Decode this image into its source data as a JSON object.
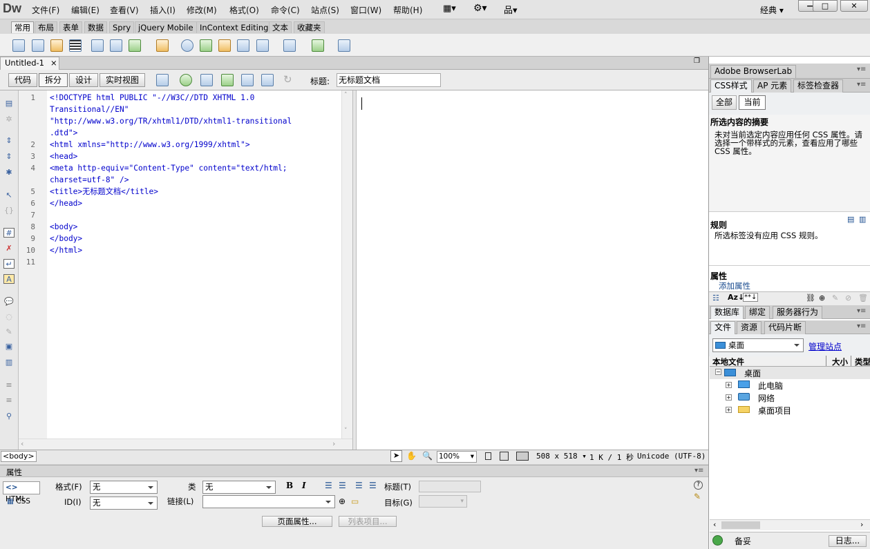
{
  "app": {
    "logo": "Dw",
    "workspace": "经典"
  },
  "menubar": {
    "items": [
      "文件(F)",
      "编辑(E)",
      "查看(V)",
      "插入(I)",
      "修改(M)",
      "格式(O)",
      "命令(C)",
      "站点(S)",
      "窗口(W)",
      "帮助(H)"
    ]
  },
  "window_controls": {
    "minimize": "—",
    "maximize": "□",
    "close": "✕"
  },
  "insert_tabs": [
    "常用",
    "布局",
    "表单",
    "数据",
    "Spry",
    "jQuery Mobile",
    "InContext Editing",
    "文本",
    "收藏夹"
  ],
  "document": {
    "tab": "Untitled-1",
    "close": "×"
  },
  "view_buttons": [
    "代码",
    "拆分",
    "设计",
    "实时视图"
  ],
  "title_label": "标题:",
  "title_value": "无标题文档",
  "code_lines": [
    {
      "n": "1",
      "t": "<!DOCTYPE html PUBLIC \"-//W3C//DTD XHTML 1.0"
    },
    {
      "n": "",
      "t": "Transitional//EN\""
    },
    {
      "n": "",
      "t": "\"http://www.w3.org/TR/xhtml1/DTD/xhtml1-transitional"
    },
    {
      "n": "",
      "t": ".dtd\">"
    },
    {
      "n": "2",
      "t": "<html xmlns=\"http://www.w3.org/1999/xhtml\">"
    },
    {
      "n": "3",
      "t": "<head>"
    },
    {
      "n": "4",
      "t": "<meta http-equiv=\"Content-Type\" content=\"text/html;"
    },
    {
      "n": "",
      "t": "charset=utf-8\" />"
    },
    {
      "n": "5",
      "t": "<title>无标题文档</title>"
    },
    {
      "n": "6",
      "t": "</head>"
    },
    {
      "n": "7",
      "t": ""
    },
    {
      "n": "8",
      "t": "<body>"
    },
    {
      "n": "9",
      "t": "</body>"
    },
    {
      "n": "10",
      "t": "</html>"
    },
    {
      "n": "11",
      "t": ""
    }
  ],
  "status": {
    "tag": "<body>",
    "zoom": "100%",
    "size": "508 x 518",
    "weight": "1 K / 1 秒",
    "encoding": "Unicode (UTF-8)"
  },
  "properties": {
    "header": "属性",
    "html_btn": "HTML",
    "css_btn": "CSS",
    "format_label": "格式(F)",
    "format_value": "无",
    "id_label": "ID(I)",
    "id_value": "无",
    "class_label": "类",
    "class_value": "无",
    "link_label": "链接(L)",
    "link_value": "",
    "title_label": "标题(T)",
    "target_label": "目标(G)",
    "page_props": "页面属性...",
    "list_item": "列表项目..."
  },
  "right": {
    "browserlab": "Adobe BrowserLab",
    "css_tabs": [
      "CSS样式",
      "AP 元素",
      "标签检查器"
    ],
    "mode_all": "全部",
    "mode_current": "当前",
    "summary_title": "所选内容的摘要",
    "summary_text": "未对当前选定内容应用任何 CSS 属性。请选择一个带样式的元素，查看应用了哪些 CSS 属性。",
    "rules_title": "规则",
    "rules_text": "所选标签没有应用 CSS 规则。",
    "attrs_title": "属性",
    "add_attr": "添加属性",
    "db_tabs": [
      "数据库",
      "绑定",
      "服务器行为"
    ],
    "file_tabs": [
      "文件",
      "资源",
      "代码片断"
    ],
    "site_select": "桌面",
    "manage_site": "管理站点",
    "col_local": "本地文件",
    "col_size": "大小",
    "col_type": "类型",
    "tree_root": "桌面",
    "tree_items": [
      "此电脑",
      "网络",
      "桌面项目"
    ],
    "footer_ready": "备妥",
    "footer_log": "日志..."
  },
  "colors": {
    "code_blue": "#0000cc",
    "link": "#0000cc"
  }
}
